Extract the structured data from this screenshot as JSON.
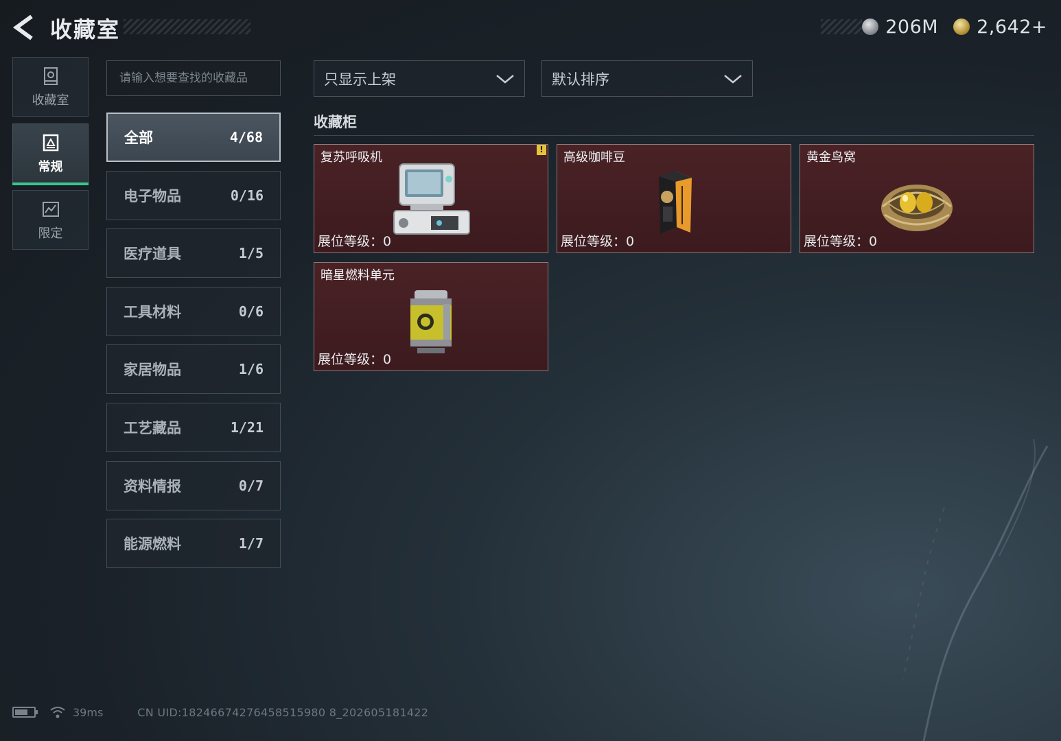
{
  "header": {
    "title": "收藏室",
    "currencies": [
      {
        "icon": "silver-coin-icon",
        "value": "206M"
      },
      {
        "icon": "gold-coin-icon",
        "value": "2,642+"
      }
    ]
  },
  "nav": [
    {
      "label": "收藏室",
      "icon": "vault-icon",
      "active": false
    },
    {
      "label": "常规",
      "icon": "collection-icon",
      "active": true
    },
    {
      "label": "限定",
      "icon": "limited-icon",
      "active": false
    }
  ],
  "search": {
    "placeholder": "请输入想要查找的收藏品"
  },
  "categories": [
    {
      "name": "全部",
      "count": "4/68",
      "active": true
    },
    {
      "name": "电子物品",
      "count": "0/16"
    },
    {
      "name": "医疗道具",
      "count": "1/5"
    },
    {
      "name": "工具材料",
      "count": "0/6"
    },
    {
      "name": "家居物品",
      "count": "1/6"
    },
    {
      "name": "工艺藏品",
      "count": "1/21"
    },
    {
      "name": "资料情报",
      "count": "0/7"
    },
    {
      "name": "能源燃料",
      "count": "1/7"
    }
  ],
  "filters": {
    "shelf_filter": "只显示上架",
    "sort": "默认排序"
  },
  "section_title": "收藏柜",
  "items": [
    {
      "name": "复苏呼吸机",
      "level": "展位等级：0",
      "alert": "!",
      "icon": "ventilator-icon"
    },
    {
      "name": "高级咖啡豆",
      "level": "展位等级：0",
      "icon": "coffee-bag-icon"
    },
    {
      "name": "黄金鸟窝",
      "level": "展位等级：0",
      "icon": "golden-nest-icon"
    },
    {
      "name": "暗星燃料单元",
      "level": "展位等级：0",
      "icon": "fuel-canister-icon"
    }
  ],
  "footer": {
    "ping": "39ms",
    "uid": "CN UID:18246674276458515980 8_202605181422"
  },
  "colors": {
    "accent_green": "#37c78d",
    "card_bg": "#4a2226",
    "alert_yellow": "#e6c43a"
  }
}
